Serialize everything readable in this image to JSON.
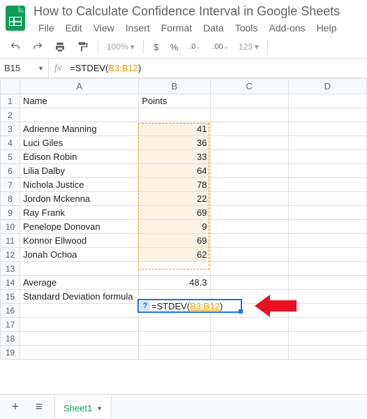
{
  "doc": {
    "title": "How to Calculate Confidence Interval in Google Sheets"
  },
  "menu": {
    "file": "File",
    "edit": "Edit",
    "view": "View",
    "insert": "Insert",
    "format": "Format",
    "data": "Data",
    "tools": "Tools",
    "addons": "Add-ons",
    "help": "Help"
  },
  "toolbar": {
    "zoom": "100%",
    "dollar": "$",
    "percent": "%",
    "dec_dec": ".0",
    "dec_inc": ".00",
    "num_format": "123"
  },
  "namebox": {
    "ref": "B15"
  },
  "formula_bar": {
    "prefix": "=STDEV(",
    "range": "B3:B12",
    "suffix": ")"
  },
  "columns": {
    "A": "A",
    "B": "B",
    "C": "C",
    "D": "D"
  },
  "headers": {
    "name": "Name",
    "points": "Points"
  },
  "people": [
    {
      "name": "Adrienne Manning",
      "points": "41"
    },
    {
      "name": "Luci Giles",
      "points": "36"
    },
    {
      "name": "Edison Robin",
      "points": "33"
    },
    {
      "name": "Lilia Dalby",
      "points": "64"
    },
    {
      "name": "Nichola Justice",
      "points": "78"
    },
    {
      "name": "Jordon Mckenna",
      "points": "22"
    },
    {
      "name": "Ray Frank",
      "points": "69"
    },
    {
      "name": "Penelope Donovan",
      "points": "9"
    },
    {
      "name": "Konnor Ellwood",
      "points": "69"
    },
    {
      "name": "Jonah Ochoa",
      "points": "62"
    }
  ],
  "summary": {
    "average_label": "Average",
    "average_value": "48.3",
    "stdev_label": "Standard Deviation formula",
    "stdev_prefix": "=STDEV(",
    "stdev_range": "B3:B12",
    "stdev_suffix": ")"
  },
  "tabs": {
    "sheet1": "Sheet1"
  },
  "rows": [
    "1",
    "2",
    "3",
    "4",
    "5",
    "6",
    "7",
    "8",
    "9",
    "10",
    "11",
    "12",
    "13",
    "14",
    "15",
    "16",
    "17",
    "18",
    "19"
  ]
}
